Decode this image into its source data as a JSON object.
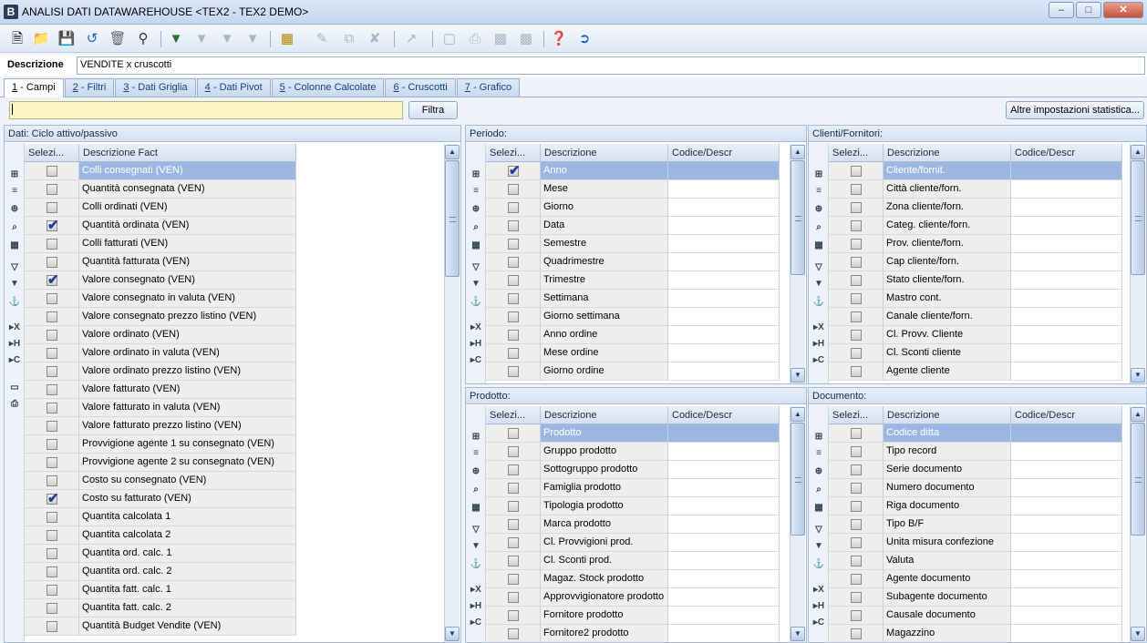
{
  "window": {
    "title": "ANALISI DATI DATAWAREHOUSE <TEX2 - TEX2 DEMO>",
    "app_icon": "B",
    "controls": [
      "minimize-icon",
      "maximize-icon",
      "close-icon"
    ]
  },
  "toolbar": {
    "icons": [
      "new-document-icon",
      "open-icon",
      "save-icon",
      "undo-icon",
      "delete-icon",
      "search-binoculars-icon",
      "filter-add-icon",
      "filter-edit-icon",
      "filter-remove-icon",
      "filter-clear-icon",
      "grid-layout-icon",
      "edit-icon",
      "copy-icon",
      "cancel-edit-icon",
      "chart-icon",
      "monitor-icon",
      "print-icon",
      "export-icon",
      "export2-icon",
      "help-icon",
      "exit-icon"
    ]
  },
  "descrizione": {
    "label": "Descrizione",
    "value": "VENDITE x cruscotti"
  },
  "tabs": [
    {
      "num": "1",
      "label": " - Campi",
      "active": true
    },
    {
      "num": "2",
      "label": " - Filtri",
      "active": false
    },
    {
      "num": "3",
      "label": " - Dati Griglia",
      "active": false
    },
    {
      "num": "4",
      "label": " - Dati Pivot",
      "active": false
    },
    {
      "num": "5",
      "label": " - Colonne Calcolate",
      "active": false
    },
    {
      "num": "6",
      "label": " - Cruscotti",
      "active": false
    },
    {
      "num": "7",
      "label": " - Grafico",
      "active": false
    }
  ],
  "filter": {
    "value": "",
    "button": "Filtra"
  },
  "altre_button": "Altre impostazioni statistica...",
  "side_icons": [
    "tree-expand-icon",
    "list-icon",
    "add-field-icon",
    "zoom-icon",
    "calculator-icon",
    "filter-icon",
    "filter-funnel-icon",
    "anchor-icon",
    "x-axis-icon",
    "h-axis-icon",
    "c-axis-icon",
    "monitor-icon",
    "printer-icon"
  ],
  "panels": {
    "dati": {
      "header": "Dati: Ciclo attivo/passivo",
      "col_sel": "Selezi...",
      "col_desc": "Descrizione Fact",
      "rows": [
        {
          "label": "Colli consegnati (VEN)",
          "checked": false
        },
        {
          "label": "Quantità consegnata (VEN)",
          "checked": false
        },
        {
          "label": "Colli ordinati (VEN)",
          "checked": false
        },
        {
          "label": "Quantità ordinata (VEN)",
          "checked": true
        },
        {
          "label": "Colli fatturati (VEN)",
          "checked": false
        },
        {
          "label": "Quantità fatturata (VEN)",
          "checked": false
        },
        {
          "label": "Valore consegnato (VEN)",
          "checked": true
        },
        {
          "label": "Valore consegnato in valuta (VEN)",
          "checked": false
        },
        {
          "label": "Valore consegnato prezzo listino (VEN)",
          "checked": false
        },
        {
          "label": "Valore ordinato (VEN)",
          "checked": false
        },
        {
          "label": "Valore ordinato in valuta (VEN)",
          "checked": false
        },
        {
          "label": "Valore ordinato prezzo listino (VEN)",
          "checked": false
        },
        {
          "label": "Valore fatturato (VEN)",
          "checked": false
        },
        {
          "label": "Valore fatturato in valuta (VEN)",
          "checked": false
        },
        {
          "label": "Valore fatturato prezzo listino (VEN)",
          "checked": false
        },
        {
          "label": "Provvigione agente 1 su consegnato (VEN)",
          "checked": false
        },
        {
          "label": "Provvigione agente 2 su consegnato (VEN)",
          "checked": false
        },
        {
          "label": "Costo su consegnato (VEN)",
          "checked": false
        },
        {
          "label": "Costo su fatturato (VEN)",
          "checked": true
        },
        {
          "label": "Quantita calcolata 1",
          "checked": false
        },
        {
          "label": "Quantita calcolata 2",
          "checked": false
        },
        {
          "label": "Quantita ord. calc. 1",
          "checked": false
        },
        {
          "label": "Quantita ord. calc. 2",
          "checked": false
        },
        {
          "label": "Quantita fatt. calc. 1",
          "checked": false
        },
        {
          "label": "Quantita fatt. calc. 2",
          "checked": false
        },
        {
          "label": "Quantità Budget Vendite (VEN)",
          "checked": false
        }
      ]
    },
    "periodo": {
      "header": "Periodo:",
      "col_sel": "Selezi...",
      "col_desc": "Descrizione",
      "col_code": "Codice/Descr",
      "rows": [
        {
          "label": "Anno",
          "checked": true
        },
        {
          "label": "Mese",
          "checked": false
        },
        {
          "label": "Giorno",
          "checked": false
        },
        {
          "label": "Data",
          "checked": false
        },
        {
          "label": "Semestre",
          "checked": false
        },
        {
          "label": "Quadrimestre",
          "checked": false
        },
        {
          "label": "Trimestre",
          "checked": false
        },
        {
          "label": "Settimana",
          "checked": false
        },
        {
          "label": "Giorno settimana",
          "checked": false
        },
        {
          "label": "Anno ordine",
          "checked": false
        },
        {
          "label": "Mese ordine",
          "checked": false
        },
        {
          "label": "Giorno ordine",
          "checked": false
        }
      ]
    },
    "clienti": {
      "header": "Clienti/Fornitori:",
      "col_sel": "Selezi...",
      "col_desc": "Descrizione",
      "col_code": "Codice/Descr",
      "rows": [
        {
          "label": "Cliente/fornit.",
          "checked": false
        },
        {
          "label": "Città cliente/forn.",
          "checked": false
        },
        {
          "label": "Zona cliente/forn.",
          "checked": false
        },
        {
          "label": "Categ. cliente/forn.",
          "checked": false
        },
        {
          "label": "Prov. cliente/forn.",
          "checked": false
        },
        {
          "label": "Cap cliente/forn.",
          "checked": false
        },
        {
          "label": "Stato cliente/forn.",
          "checked": false
        },
        {
          "label": "Mastro cont.",
          "checked": false
        },
        {
          "label": "Canale cliente/forn.",
          "checked": false
        },
        {
          "label": "Cl. Provv. Cliente",
          "checked": false
        },
        {
          "label": "Cl. Sconti cliente",
          "checked": false
        },
        {
          "label": "Agente cliente",
          "checked": false
        }
      ]
    },
    "prodotto": {
      "header": "Prodotto:",
      "col_sel": "Selezi...",
      "col_desc": "Descrizione",
      "col_code": "Codice/Descr",
      "rows": [
        {
          "label": "Prodotto",
          "checked": false
        },
        {
          "label": "Gruppo prodotto",
          "checked": false
        },
        {
          "label": "Sottogruppo prodotto",
          "checked": false
        },
        {
          "label": "Famiglia prodotto",
          "checked": false
        },
        {
          "label": "Tipologia prodotto",
          "checked": false
        },
        {
          "label": "Marca prodotto",
          "checked": false
        },
        {
          "label": "Cl. Provvigioni prod.",
          "checked": false
        },
        {
          "label": "Cl. Sconti prod.",
          "checked": false
        },
        {
          "label": "Magaz. Stock prodotto",
          "checked": false
        },
        {
          "label": "Approvvigionatore prodotto",
          "checked": false
        },
        {
          "label": "Fornitore prodotto",
          "checked": false
        },
        {
          "label": "Fornitore2 prodotto",
          "checked": false
        }
      ]
    },
    "documento": {
      "header": "Documento:",
      "col_sel": "Selezi...",
      "col_desc": "Descrizione",
      "col_code": "Codice/Descr",
      "rows": [
        {
          "label": "Codice ditta",
          "checked": false
        },
        {
          "label": "Tipo record",
          "checked": false
        },
        {
          "label": "Serie documento",
          "checked": false
        },
        {
          "label": "Numero documento",
          "checked": false
        },
        {
          "label": "Riga documento",
          "checked": false
        },
        {
          "label": "Tipo B/F",
          "checked": false
        },
        {
          "label": "Unita misura confezione",
          "checked": false
        },
        {
          "label": "Valuta",
          "checked": false
        },
        {
          "label": "Agente documento",
          "checked": false
        },
        {
          "label": "Subagente documento",
          "checked": false
        },
        {
          "label": "Causale documento",
          "checked": false
        },
        {
          "label": "Magazzino",
          "checked": false
        }
      ]
    }
  }
}
